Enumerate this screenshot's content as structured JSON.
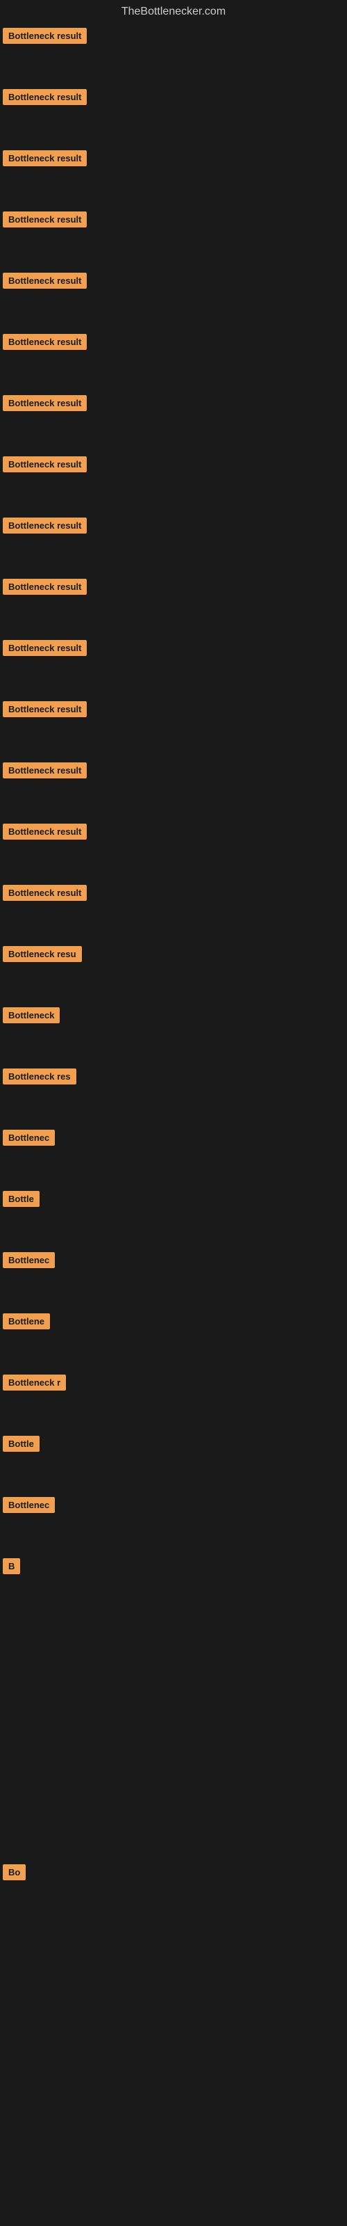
{
  "site": {
    "title": "TheBottlenecker.com"
  },
  "rows": [
    {
      "id": 1,
      "label": "Bottleneck result",
      "badge_width": 135
    },
    {
      "id": 2,
      "label": "Bottleneck result",
      "badge_width": 130
    },
    {
      "id": 3,
      "label": "Bottleneck result",
      "badge_width": 128
    },
    {
      "id": 4,
      "label": "Bottleneck result",
      "badge_width": 125
    },
    {
      "id": 5,
      "label": "Bottleneck result",
      "badge_width": 135
    },
    {
      "id": 6,
      "label": "Bottleneck result",
      "badge_width": 130
    },
    {
      "id": 7,
      "label": "Bottleneck result",
      "badge_width": 128
    },
    {
      "id": 8,
      "label": "Bottleneck result",
      "badge_width": 125
    },
    {
      "id": 9,
      "label": "Bottleneck result",
      "badge_width": 130
    },
    {
      "id": 10,
      "label": "Bottleneck result",
      "badge_width": 128
    },
    {
      "id": 11,
      "label": "Bottleneck result",
      "badge_width": 125
    },
    {
      "id": 12,
      "label": "Bottleneck result",
      "badge_width": 130
    },
    {
      "id": 13,
      "label": "Bottleneck result",
      "badge_width": 128
    },
    {
      "id": 14,
      "label": "Bottleneck result",
      "badge_width": 125
    },
    {
      "id": 15,
      "label": "Bottleneck result",
      "badge_width": 125
    },
    {
      "id": 16,
      "label": "Bottleneck resu",
      "badge_width": 112
    },
    {
      "id": 17,
      "label": "Bottleneck",
      "badge_width": 78
    },
    {
      "id": 18,
      "label": "Bottleneck res",
      "badge_width": 105
    },
    {
      "id": 19,
      "label": "Bottlenec",
      "badge_width": 70
    },
    {
      "id": 20,
      "label": "Bottle",
      "badge_width": 48
    },
    {
      "id": 21,
      "label": "Bottlenec",
      "badge_width": 70
    },
    {
      "id": 22,
      "label": "Bottlene",
      "badge_width": 60
    },
    {
      "id": 23,
      "label": "Bottleneck r",
      "badge_width": 88
    },
    {
      "id": 24,
      "label": "Bottle",
      "badge_width": 48
    },
    {
      "id": 25,
      "label": "Bottlenec",
      "badge_width": 70
    },
    {
      "id": 26,
      "label": "B",
      "badge_width": 18
    },
    {
      "id": 27,
      "label": "",
      "badge_width": 0
    },
    {
      "id": 28,
      "label": "",
      "badge_width": 0
    },
    {
      "id": 29,
      "label": "",
      "badge_width": 0
    },
    {
      "id": 30,
      "label": "",
      "badge_width": 0
    },
    {
      "id": 31,
      "label": "Bo",
      "badge_width": 24
    },
    {
      "id": 32,
      "label": "",
      "badge_width": 0
    },
    {
      "id": 33,
      "label": "",
      "badge_width": 0
    },
    {
      "id": 34,
      "label": "",
      "badge_width": 0
    },
    {
      "id": 35,
      "label": "",
      "badge_width": 0
    },
    {
      "id": 36,
      "label": "",
      "badge_width": 0
    }
  ]
}
